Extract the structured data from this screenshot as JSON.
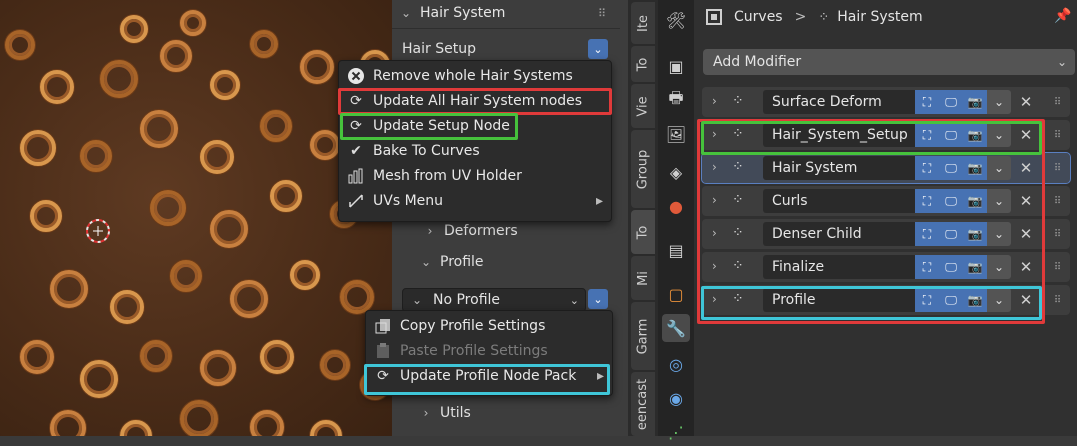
{
  "colors": {
    "highlight_red": "#e03a3a",
    "highlight_green": "#46c23c",
    "highlight_cyan": "#3fc6d8",
    "accent_blue": "#4772b3"
  },
  "properties": {
    "hair_system_header": "Hair System",
    "hair_setup_label": "Hair Setup",
    "deformers_label": "Deformers",
    "profile_label": "Profile",
    "profile_dropdown": "No Profile",
    "utils_label": "Utils"
  },
  "setup_menu": {
    "items": [
      {
        "label": "Remove whole Hair Systems",
        "icon": "close-circle-icon"
      },
      {
        "label": "Update All Hair System nodes",
        "icon": "refresh-icon"
      },
      {
        "label": "Update Setup Node",
        "icon": "refresh-icon"
      },
      {
        "label": "Bake To Curves",
        "icon": "checkmark-icon"
      },
      {
        "label": "Mesh from UV Holder",
        "icon": "mesh-icon"
      },
      {
        "label": "UVs Menu",
        "icon": "uv-icon",
        "submenu_arrow": "▸"
      }
    ]
  },
  "profile_menu": {
    "items": [
      {
        "label": "Copy Profile Settings",
        "icon": "copy-icon",
        "enabled": true
      },
      {
        "label": "Paste Profile Settings",
        "icon": "paste-icon",
        "enabled": false
      },
      {
        "label": "Update Profile Node Pack",
        "icon": "refresh-icon",
        "enabled": true,
        "submenu_arrow": "▸"
      }
    ]
  },
  "side_tabs": [
    "Ite",
    "To",
    "Vie",
    "Group",
    "To",
    "Mi",
    "Garm",
    "eencast"
  ],
  "breadcrumb": {
    "object": "Curves",
    "separator": ">",
    "data": "Hair System"
  },
  "add_modifier_label": "Add Modifier",
  "modifiers": [
    {
      "name": "Surface Deform"
    },
    {
      "name": "Hair_System_Setup"
    },
    {
      "name": "Hair System"
    },
    {
      "name": "Curls"
    },
    {
      "name": "Denser Child"
    },
    {
      "name": "Finalize"
    },
    {
      "name": "Profile"
    }
  ],
  "glyphs": {
    "chevron_right": "›",
    "chevron_down": "⌄",
    "close": "✕",
    "grip": "⠿"
  }
}
